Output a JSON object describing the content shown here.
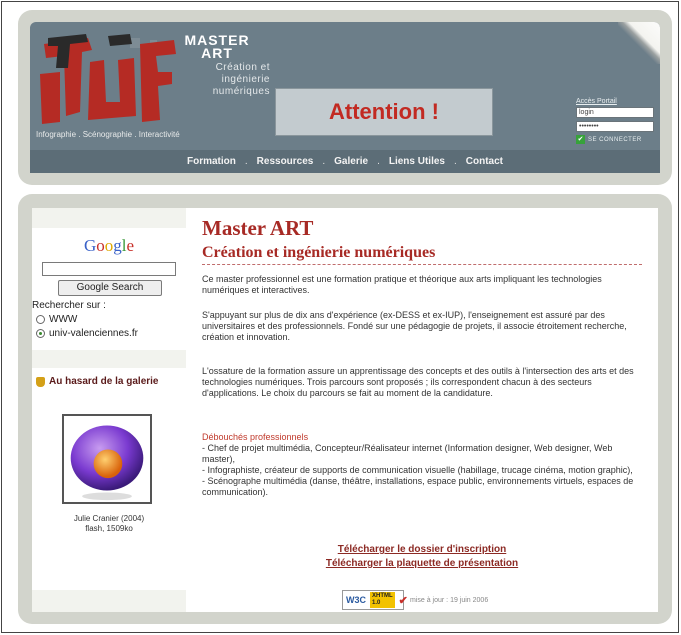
{
  "header": {
    "master_title": "MASTER ART",
    "master_subtitle": "Création et ingénierie numériques",
    "logo_subtitle": "Infographie . Scénographie . Interactivité",
    "attention": "Attention !",
    "portal": {
      "link": "Accès Portail",
      "login_value": "login",
      "password_value": "••••••••",
      "connect_label": "SE CONNECTER"
    }
  },
  "nav": {
    "items": [
      "Formation",
      "Ressources",
      "Galerie",
      "Liens Utiles",
      "Contact"
    ],
    "separator": "."
  },
  "sidebar": {
    "google_logo": "Google",
    "google_button": "Google Search",
    "search_label": "Rechercher sur :",
    "radio_options": [
      "WWW",
      "univ-valenciennes.fr"
    ],
    "gallery_title": "Au hasard de la galerie",
    "gallery_author": "Julie Cranier",
    "gallery_year": "(2004)",
    "gallery_info": "flash, 1509ko"
  },
  "main": {
    "title": "Master ART",
    "subtitle": "Création et ingénierie numériques",
    "p1": "Ce master professionnel est une formation pratique et théorique aux arts impliquant les technologies numériques et interactives.",
    "p2": "S'appuyant sur plus de dix ans d'expérience (ex-DESS et ex-IUP), l'enseignement est assuré par des universitaires et des professionnels. Fondé sur une pédagogie de projets, il associe étroitement recherche, création et innovation.",
    "p3": "L'ossature de la formation assure un apprentissage des concepts et des outils à l'intersection des arts et des technologies numériques. Trois parcours sont proposés ; ils correspondent chacun à des secteurs d'applications. Le choix du parcours se fait au moment de la candidature.",
    "deb_title": "Débouchés professionnels",
    "deb_lines": [
      "- Chef de projet multimédia, Concepteur/Réalisateur internet (Information designer, Web designer, Web master),",
      "- Infographiste, créateur de supports de communication visuelle (habillage, trucage cinéma, motion graphic),",
      "- Scénographe multimédia (danse, théâtre, installations, espace public, environnements virtuels, espaces de communication)."
    ],
    "link1": "Télécharger le dossier d'inscription",
    "link2": "Télécharger la plaquette de présentation",
    "w3c": "W3C",
    "xhtml": "XHTML 1.0",
    "updated": "mise à jour : 19 juin 2006"
  },
  "colors": {
    "accent_red": "#a72a25",
    "banner": "#6c7e89",
    "nav_bar": "#5c6d77",
    "frame_bg": "#d2d4cc"
  }
}
